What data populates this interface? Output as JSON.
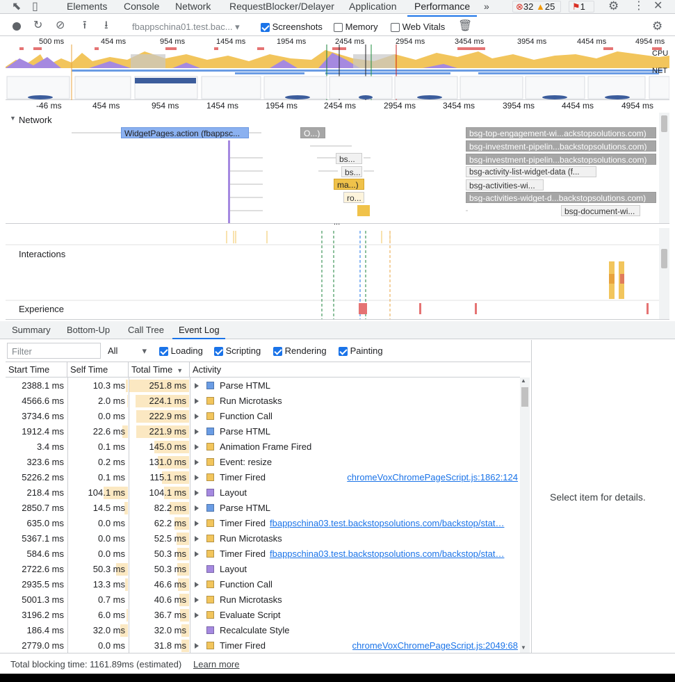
{
  "tabs": {
    "elements": "Elements",
    "console": "Console",
    "network": "Network",
    "request_blocker": "RequestBlocker/Delayer",
    "application": "Application",
    "performance": "Performance",
    "more": "»"
  },
  "badges": {
    "errors": "32",
    "warnings": "25",
    "issues": "1"
  },
  "toolbar": {
    "profile_select": "fbappschina01.test.bac...",
    "screenshots": "Screenshots",
    "memory": "Memory",
    "web_vitals": "Web Vitals"
  },
  "overview": {
    "ticks": [
      "500 ms",
      "454 ms",
      "954 ms",
      "1454 ms",
      "1954 ms",
      "2454 ms",
      "2954 ms",
      "3454 ms",
      "3954 ms",
      "4454 ms",
      "4954 ms"
    ],
    "cpu_label": "CPU",
    "net_label": "NET"
  },
  "timeline": {
    "ticks": [
      "-46 ms",
      "454 ms",
      "954 ms",
      "1454 ms",
      "1954 ms",
      "2454 ms",
      "2954 ms",
      "3454 ms",
      "3954 ms",
      "4454 ms",
      "4954 ms"
    ],
    "network_label": "Network",
    "more": "...",
    "interactions_label": "Interactions",
    "experience_label": "Experience"
  },
  "network_bars": {
    "widget_pages": "WidgetPages.action (fbappsc...",
    "o": "O...)",
    "bs1": "bs...",
    "bs2": "bs...",
    "ma": "ma...)",
    "ro": "ro...",
    "engagement": "bsg-top-engagement-wi...ackstopsolutions.com)",
    "pipeline1": "bsg-investment-pipelin...backstopsolutions.com)",
    "pipeline2": "bsg-investment-pipelin...backstopsolutions.com)",
    "activity_list": "bsg-activity-list-widget-data (f...",
    "activities_wi": "bsg-activities-wi...",
    "activities_widget": "bsg-activities-widget-d...backstopsolutions.com)",
    "document": "bsg-document-wi..."
  },
  "bottom_tabs": {
    "summary": "Summary",
    "bottom_up": "Bottom-Up",
    "call_tree": "Call Tree",
    "event_log": "Event Log"
  },
  "filter": {
    "placeholder": "Filter",
    "all": "All",
    "loading": "Loading",
    "scripting": "Scripting",
    "rendering": "Rendering",
    "painting": "Painting"
  },
  "columns": {
    "start": "Start Time",
    "self": "Self Time",
    "total": "Total Time",
    "activity": "Activity"
  },
  "colors": {
    "loading": "#6a9ce4",
    "scripting": "#f2c55c",
    "rendering": "#a589e0",
    "accent": "#1a73e8"
  },
  "rows": [
    {
      "start": "2388.1 ms",
      "self": "10.3 ms",
      "self_frac": 0.04,
      "total": "251.8 ms",
      "total_frac": 1.0,
      "expand": true,
      "cat": "loading",
      "activity": "Parse HTML",
      "link": ""
    },
    {
      "start": "4566.6 ms",
      "self": "2.0 ms",
      "self_frac": 0.01,
      "total": "224.1 ms",
      "total_frac": 0.89,
      "expand": true,
      "cat": "scripting",
      "activity": "Run Microtasks",
      "link": ""
    },
    {
      "start": "3734.6 ms",
      "self": "0.0 ms",
      "self_frac": 0.0,
      "total": "222.9 ms",
      "total_frac": 0.885,
      "expand": true,
      "cat": "scripting",
      "activity": "Function Call",
      "link": ""
    },
    {
      "start": "1912.4 ms",
      "self": "22.6 ms",
      "self_frac": 0.09,
      "total": "221.9 ms",
      "total_frac": 0.88,
      "expand": true,
      "cat": "loading",
      "activity": "Parse HTML",
      "link": ""
    },
    {
      "start": "3.4 ms",
      "self": "0.1 ms",
      "self_frac": 0.0,
      "total": "145.0 ms",
      "total_frac": 0.576,
      "expand": true,
      "cat": "scripting",
      "activity": "Animation Frame Fired",
      "link": ""
    },
    {
      "start": "323.6 ms",
      "self": "0.2 ms",
      "self_frac": 0.0,
      "total": "131.0 ms",
      "total_frac": 0.52,
      "expand": true,
      "cat": "scripting",
      "activity": "Event: resize",
      "link": ""
    },
    {
      "start": "5226.2 ms",
      "self": "0.1 ms",
      "self_frac": 0.0,
      "total": "115.1 ms",
      "total_frac": 0.457,
      "expand": true,
      "cat": "scripting",
      "activity": "Timer Fired",
      "link": "chromeVoxChromePageScript.js:1862:124"
    },
    {
      "start": "218.4 ms",
      "self": "104.1 ms",
      "self_frac": 0.41,
      "total": "104.1 ms",
      "total_frac": 0.413,
      "expand": true,
      "cat": "rendering",
      "activity": "Layout",
      "link": ""
    },
    {
      "start": "2850.7 ms",
      "self": "14.5 ms",
      "self_frac": 0.06,
      "total": "82.2 ms",
      "total_frac": 0.326,
      "expand": true,
      "cat": "loading",
      "activity": "Parse HTML",
      "link": ""
    },
    {
      "start": "635.0 ms",
      "self": "0.0 ms",
      "self_frac": 0.0,
      "total": "62.2 ms",
      "total_frac": 0.247,
      "expand": true,
      "cat": "scripting",
      "activity": "Timer Fired",
      "link": "fbappschina03.test.backstopsolutions.com/backstop/stat…"
    },
    {
      "start": "5367.1 ms",
      "self": "0.0 ms",
      "self_frac": 0.0,
      "total": "52.5 ms",
      "total_frac": 0.208,
      "expand": true,
      "cat": "scripting",
      "activity": "Run Microtasks",
      "link": ""
    },
    {
      "start": "584.6 ms",
      "self": "0.0 ms",
      "self_frac": 0.0,
      "total": "50.3 ms",
      "total_frac": 0.2,
      "expand": true,
      "cat": "scripting",
      "activity": "Timer Fired",
      "link": "fbappschina03.test.backstopsolutions.com/backstop/stat…"
    },
    {
      "start": "2722.6 ms",
      "self": "50.3 ms",
      "self_frac": 0.2,
      "total": "50.3 ms",
      "total_frac": 0.2,
      "expand": false,
      "cat": "rendering",
      "activity": "Layout",
      "link": ""
    },
    {
      "start": "2935.5 ms",
      "self": "13.3 ms",
      "self_frac": 0.05,
      "total": "46.6 ms",
      "total_frac": 0.185,
      "expand": true,
      "cat": "scripting",
      "activity": "Function Call",
      "link": ""
    },
    {
      "start": "5001.3 ms",
      "self": "0.7 ms",
      "self_frac": 0.0,
      "total": "40.6 ms",
      "total_frac": 0.161,
      "expand": true,
      "cat": "scripting",
      "activity": "Run Microtasks",
      "link": ""
    },
    {
      "start": "3196.2 ms",
      "self": "6.0 ms",
      "self_frac": 0.02,
      "total": "36.7 ms",
      "total_frac": 0.146,
      "expand": true,
      "cat": "scripting",
      "activity": "Evaluate Script",
      "link": ""
    },
    {
      "start": "186.4 ms",
      "self": "32.0 ms",
      "self_frac": 0.13,
      "total": "32.0 ms",
      "total_frac": 0.127,
      "expand": false,
      "cat": "rendering",
      "activity": "Recalculate Style",
      "link": ""
    },
    {
      "start": "2779.0 ms",
      "self": "0.0 ms",
      "self_frac": 0.0,
      "total": "31.8 ms",
      "total_frac": 0.126,
      "expand": true,
      "cat": "scripting",
      "activity": "Timer Fired",
      "link": "chromeVoxChromePageScript.js:2049:68"
    }
  ],
  "details": {
    "placeholder": "Select item for details."
  },
  "footer": {
    "text": "Total blocking time: 1161.89ms (estimated)",
    "learn_more": "Learn more"
  }
}
